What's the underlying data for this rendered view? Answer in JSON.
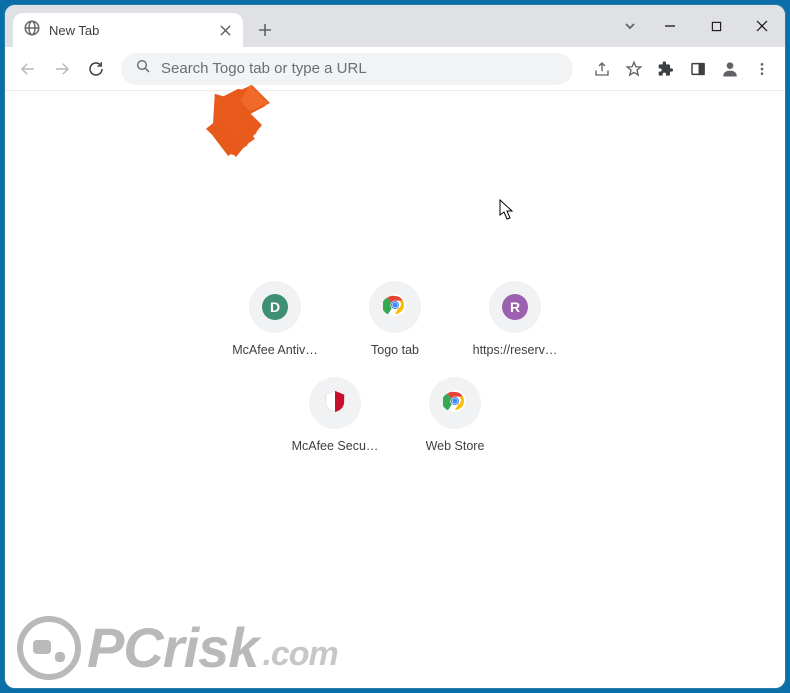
{
  "tab": {
    "title": "New Tab"
  },
  "omnibox": {
    "placeholder": "Search Togo tab or type a URL",
    "value": ""
  },
  "shortcuts": {
    "row1": [
      {
        "label": "McAfee Antiv…",
        "letter": "D",
        "bg": "#3f8f74",
        "icon": "letter"
      },
      {
        "label": "Togo tab",
        "icon": "chrome"
      },
      {
        "label": "https://reserv…",
        "letter": "R",
        "bg": "#9d5fb0",
        "icon": "letter"
      }
    ],
    "row2": [
      {
        "label": "McAfee Secu…",
        "icon": "shield"
      },
      {
        "label": "Web Store",
        "icon": "chrome"
      }
    ]
  },
  "watermark": {
    "text": "PCrisk",
    "suffix": ".com"
  }
}
